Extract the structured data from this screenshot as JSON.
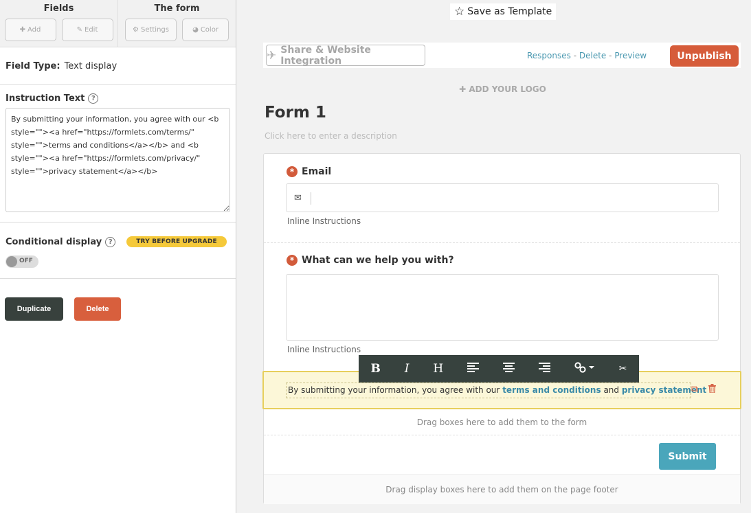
{
  "sidebar": {
    "groups": [
      {
        "title": "Fields",
        "buttons": [
          {
            "icon": "plus-icon",
            "label": "Add"
          },
          {
            "icon": "pencil-icon",
            "label": "Edit"
          }
        ]
      },
      {
        "title": "The form",
        "buttons": [
          {
            "icon": "gear-icon",
            "label": "Settings"
          },
          {
            "icon": "palette-icon",
            "label": "Color"
          }
        ]
      }
    ],
    "field_type_label": "Field Type:",
    "field_type_value": "Text display",
    "instruction_label": "Instruction Text",
    "instruction_value": "By submitting your information, you agree with our <b style=\"\"><a href=\"https://formlets.com/terms/\" style=\"\">terms and conditions</a></b> and <b style=\"\"><a href=\"https://formlets.com/privacy/\" style=\"\">privacy statement</a></b>",
    "conditional_label": "Conditional display",
    "try_badge": "TRY BEFORE UPGRADE",
    "toggle_text": "OFF",
    "duplicate_label": "Duplicate",
    "delete_label": "Delete"
  },
  "main": {
    "save_template": "Save as Template",
    "share_label": "Share & Website Integration",
    "links": {
      "responses": "Responses",
      "delete": "Delete",
      "preview": "Preview",
      "sep": "-"
    },
    "unpublish": "Unpublish",
    "add_logo": "ADD YOUR LOGO",
    "form_title": "Form 1",
    "form_desc": "Click here to enter a description",
    "fields": {
      "email_label": "Email",
      "email_inline": "Inline Instructions",
      "help_label": "What can we help you with?",
      "help_inline": "Inline Instructions"
    },
    "toolbar": {
      "bold": "B",
      "italic": "I",
      "heading": "H"
    },
    "text_block": {
      "pre": "By submitting your information, you agree with our",
      "link1": "terms and conditions",
      "mid": "and",
      "link2": "privacy statement"
    },
    "drag_fields": "Drag boxes here to add them to the form",
    "submit": "Submit",
    "drag_footer": "Drag display boxes here to add them on the page footer"
  },
  "colors": {
    "accent": "#d65c3a",
    "link": "#4a98b0",
    "submit": "#4aa6bb",
    "toolbar": "#37423e",
    "highlight_bg": "#fcf7d8",
    "highlight_border": "#e7cf5c",
    "badge": "#f5c93a"
  }
}
